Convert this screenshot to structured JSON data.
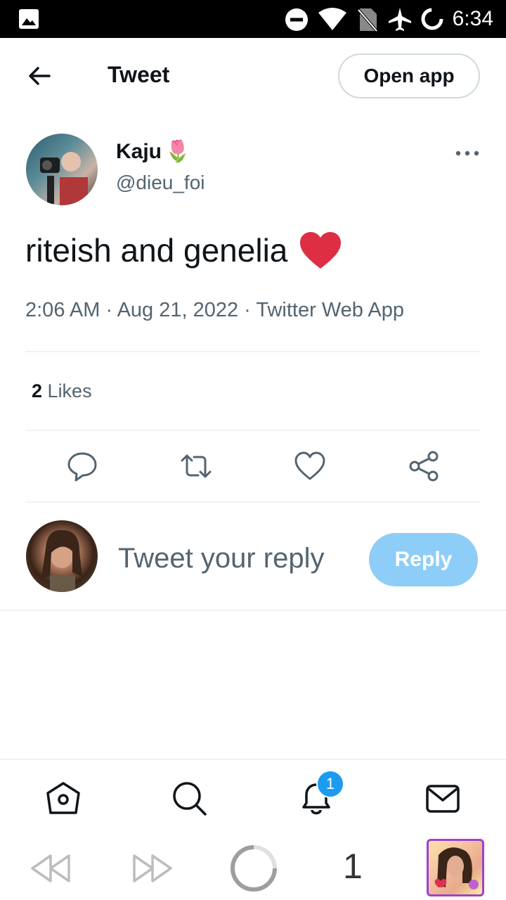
{
  "status_bar": {
    "time": "6:34",
    "icons": [
      "image-icon",
      "do-not-disturb-icon",
      "wifi-icon",
      "no-sim-icon",
      "airplane-mode-icon",
      "battery-icon"
    ]
  },
  "header": {
    "back_icon": "arrow-left-icon",
    "title": "Tweet",
    "open_app_label": "Open app"
  },
  "tweet": {
    "author_name": "Kaju",
    "author_emoji": "🌷",
    "author_handle": "@dieu_foi",
    "text": "riteish and genelia",
    "text_emoji": "❤️",
    "timestamp": "2:06 AM · Aug 21, 2022 · Twitter Web App",
    "likes_count": "2",
    "likes_label": "Likes",
    "actions": [
      "reply-icon",
      "retweet-icon",
      "like-icon",
      "share-icon"
    ]
  },
  "reply": {
    "placeholder": "Tweet your reply",
    "button_label": "Reply"
  },
  "bottom_nav": {
    "items": [
      "home-icon",
      "search-icon",
      "notifications-icon",
      "messages-icon"
    ],
    "notification_badge": "1"
  },
  "browser_bar": {
    "controls": [
      "rewind-icon",
      "fast-forward-icon",
      "loading-spinner-icon"
    ],
    "tab_count": "1"
  },
  "colors": {
    "accent": "#1d9bf0",
    "reply_button": "#8ecdf8",
    "secondary_text": "#536471",
    "divider": "#eff3f4"
  }
}
